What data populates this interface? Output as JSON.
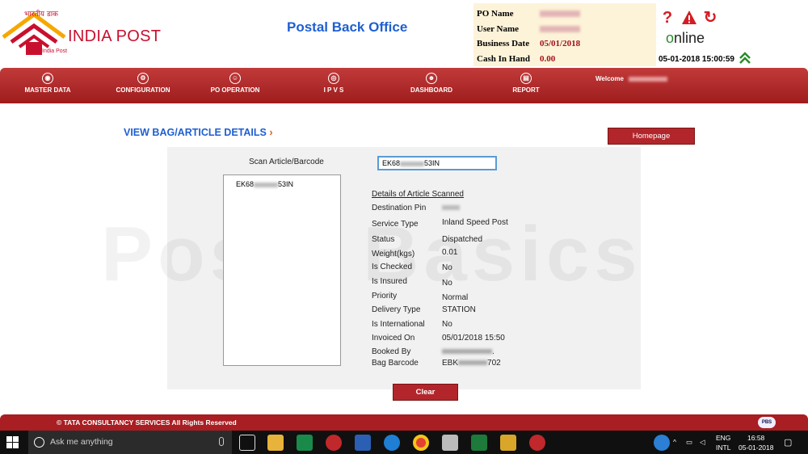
{
  "header": {
    "logo_hindi": "भारतीय डाक",
    "logo_text": "INDIA POST",
    "logo_small": "India Post",
    "app_title": "Postal Back Office",
    "info": {
      "po_name_label": "PO Name",
      "user_name_label": "User Name",
      "business_date_label": "Business Date",
      "business_date_value": "05/01/2018",
      "cash_label": "Cash In Hand",
      "cash_value": "0.00"
    },
    "help_icon": "?",
    "alert_icon": "!",
    "refresh_icon": "↻",
    "online_o": "o",
    "online_rest": "nline",
    "datetime": "05-01-2018 15:00:59"
  },
  "nav": {
    "items": [
      {
        "label": "MASTER DATA"
      },
      {
        "label": "CONFIGURATION"
      },
      {
        "label": "PO OPERATION"
      },
      {
        "label": "I P V S"
      },
      {
        "label": "DASHBOARD"
      },
      {
        "label": "REPORT"
      }
    ],
    "welcome": "Welcome"
  },
  "content": {
    "page_title": "VIEW BAG/ARTICLE DETAILS",
    "page_title_chevron": "›",
    "homepage_button": "Homepage",
    "watermark": "Posta Basics",
    "scan_label": "Scan Article/Barcode",
    "scan_value_prefix": "EK68",
    "scan_value_suffix": "53IN",
    "list_item_prefix": "EK68",
    "list_item_suffix": "53IN",
    "details_title": "Details of Article Scanned",
    "details": [
      {
        "label": "Destination Pin",
        "value": ""
      },
      {
        "label": "Service Type",
        "value": "Inland Speed Post"
      },
      {
        "label": "Status",
        "value": "Dispatched"
      },
      {
        "label": "Weight(kgs)",
        "value": "0.01"
      },
      {
        "label": "Is Checked",
        "value": "No"
      },
      {
        "label": "Is Insured",
        "value": "No"
      },
      {
        "label": "Priority",
        "value": "Normal"
      },
      {
        "label": "Delivery Type",
        "value": "STATION"
      },
      {
        "label": "Is International",
        "value": "No"
      },
      {
        "label": "Invoiced On",
        "value": "05/01/2018 15:50"
      },
      {
        "label": "Booked By",
        "value": "."
      },
      {
        "label": "Bag Barcode",
        "value_prefix": "EBK",
        "value_suffix": "702"
      }
    ],
    "clear_button": "Clear"
  },
  "footer": {
    "text": "© TATA CONSULTANCY SERVICES     All Rights Reserved",
    "badge": "PBS"
  },
  "taskbar": {
    "search_placeholder": "Ask me anything",
    "lang_1": "ENG",
    "lang_2": "INTL",
    "time": "16:58",
    "date": "05-01-2018"
  }
}
